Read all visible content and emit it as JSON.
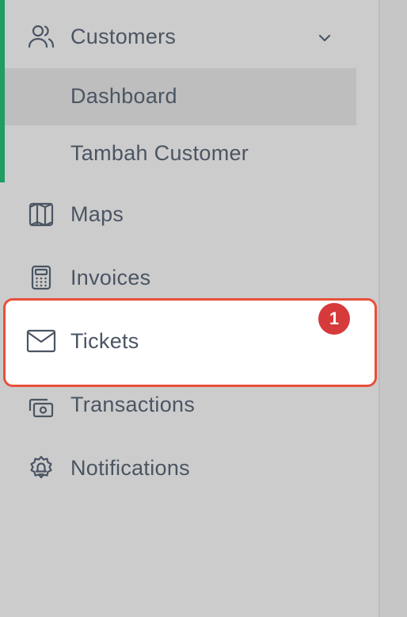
{
  "sidebar": {
    "customers": {
      "label": "Customers",
      "icon": "users-icon",
      "expanded": true,
      "submenu": [
        {
          "label": "Dashboard",
          "active": true
        },
        {
          "label": "Tambah Customer",
          "active": false
        }
      ]
    },
    "items": [
      {
        "label": "Maps",
        "icon": "map-icon"
      },
      {
        "label": "Invoices",
        "icon": "calculator-icon"
      },
      {
        "label": "Tickets",
        "icon": "mail-icon",
        "badge": "1",
        "highlighted": true
      },
      {
        "label": "Transactions",
        "icon": "cash-icon"
      },
      {
        "label": "Notifications",
        "icon": "bell-gear-icon"
      }
    ]
  },
  "colors": {
    "accent": "#1f9d63",
    "highlight_border": "#e8503a",
    "badge": "#d63a3a",
    "text": "#4b5563",
    "background": "#cccccc"
  }
}
